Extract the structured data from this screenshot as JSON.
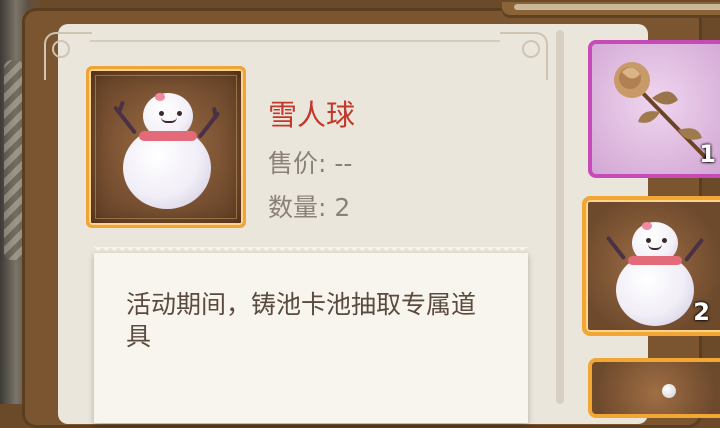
{
  "item": {
    "name": "雪人球",
    "price_label": "售价: --",
    "count_label": "数量: 2",
    "icon": "snowman-icon",
    "rarity_color": "#f0a437"
  },
  "description": {
    "text": "活动期间，铸池卡池抽取专属道具"
  },
  "inventory": [
    {
      "icon": "rose-icon",
      "quantity": "1",
      "rarity_color": "#c64ab8"
    },
    {
      "icon": "snowman-icon",
      "quantity": "2",
      "rarity_color": "#f2a634"
    },
    {
      "icon": "pearl-icon",
      "quantity": "",
      "rarity_color": "#f2a634"
    }
  ],
  "colors": {
    "item_name": "#c0392b",
    "panel": "#ebe6dc",
    "frame": "#7a5530"
  }
}
